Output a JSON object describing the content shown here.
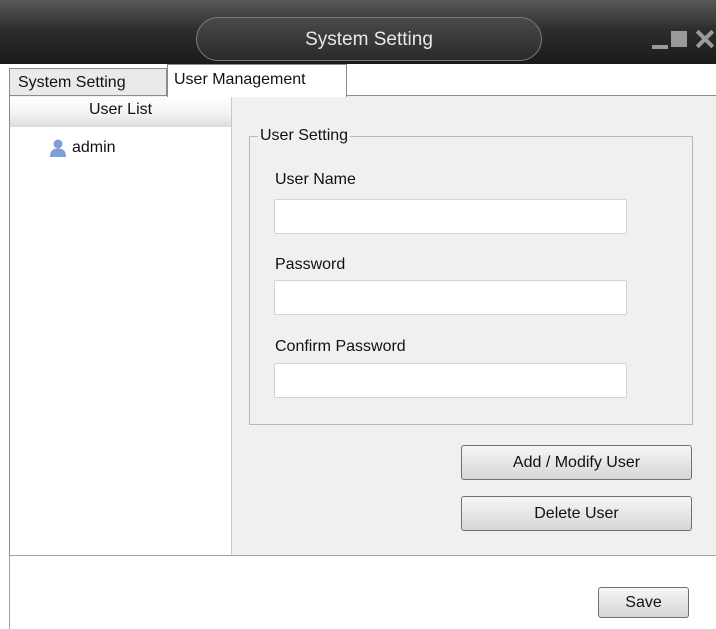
{
  "window": {
    "title": "System Setting"
  },
  "tabs": [
    {
      "label": "System Setting",
      "active": false
    },
    {
      "label": "User Management",
      "active": true
    }
  ],
  "user_list": {
    "header": "User List",
    "users": [
      "admin"
    ]
  },
  "user_setting": {
    "legend": "User Setting",
    "user_name_label": "User Name",
    "user_name_value": "",
    "password_label": "Password",
    "password_value": "",
    "confirm_password_label": "Confirm Password",
    "confirm_password_value": ""
  },
  "buttons": {
    "add_modify": "Add / Modify User",
    "delete": "Delete User",
    "save": "Save"
  },
  "colors": {
    "titlebar": "#2e2e2e",
    "panel": "#f0f0f0",
    "user_icon": "#7fa0d6"
  }
}
